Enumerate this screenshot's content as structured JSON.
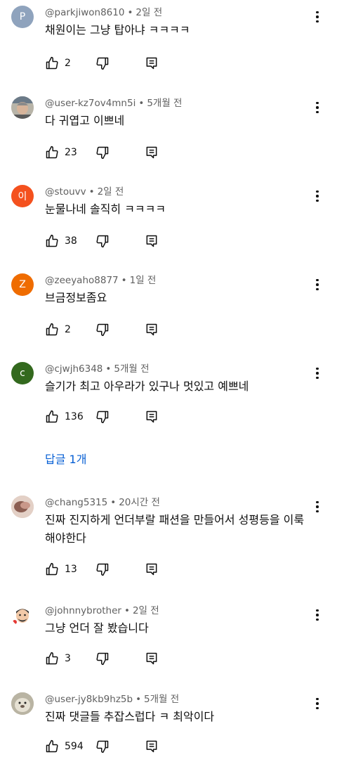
{
  "comments": [
    {
      "author": "@parkjiwon8610",
      "time": "2일 전",
      "text": "채원이는 그냥 탑아냐 ㅋㅋㅋㅋ",
      "likes": "2",
      "avatar": {
        "type": "letter",
        "letter": "P",
        "color": "#8fa3bd"
      }
    },
    {
      "author": "@user-kz7ov4mn5i",
      "time": "5개월 전",
      "text": "다 귀엽고 이쁘네",
      "likes": "23",
      "avatar": {
        "type": "image",
        "icon": "user-photo-icon"
      }
    },
    {
      "author": "@stouvv",
      "time": "2일 전",
      "text": "눈물나네 솔직히 ㅋㅋㅋㅋ",
      "likes": "38",
      "avatar": {
        "type": "letter",
        "letter": "이",
        "color": "#f4511e"
      }
    },
    {
      "author": "@zeeyaho8877",
      "time": "1일 전",
      "text": "브금정보좀요",
      "likes": "2",
      "avatar": {
        "type": "letter",
        "letter": "Z",
        "color": "#ef6c00"
      }
    },
    {
      "author": "@cjwjh6348",
      "time": "5개월 전",
      "text": "슬기가 최고 아우라가 있구나 멋있고 예쁘네",
      "likes": "136",
      "avatar": {
        "type": "letter",
        "letter": "c",
        "color": "#33691e"
      },
      "replies": "답글 1개"
    },
    {
      "author": "@chang5315",
      "time": "20시간 전",
      "text": "진짜 진지하게 언더부랄 패션을 만들어서 성평등을 이룩해야한다",
      "likes": "13",
      "avatar": {
        "type": "image",
        "icon": "user-photo-icon"
      }
    },
    {
      "author": "@johnnybrother",
      "time": "2일 전",
      "text": "그냥 언더 잘 봤습니다",
      "likes": "3",
      "avatar": {
        "type": "image",
        "icon": "cartoon-face-icon"
      }
    },
    {
      "author": "@user-jy8kb9hz5b",
      "time": "5개월 전",
      "text": "진짜 댓글들 추잡스럽다 ㅋ 최악이다",
      "likes": "594",
      "avatar": {
        "type": "image",
        "icon": "seal-photo-icon"
      }
    }
  ]
}
